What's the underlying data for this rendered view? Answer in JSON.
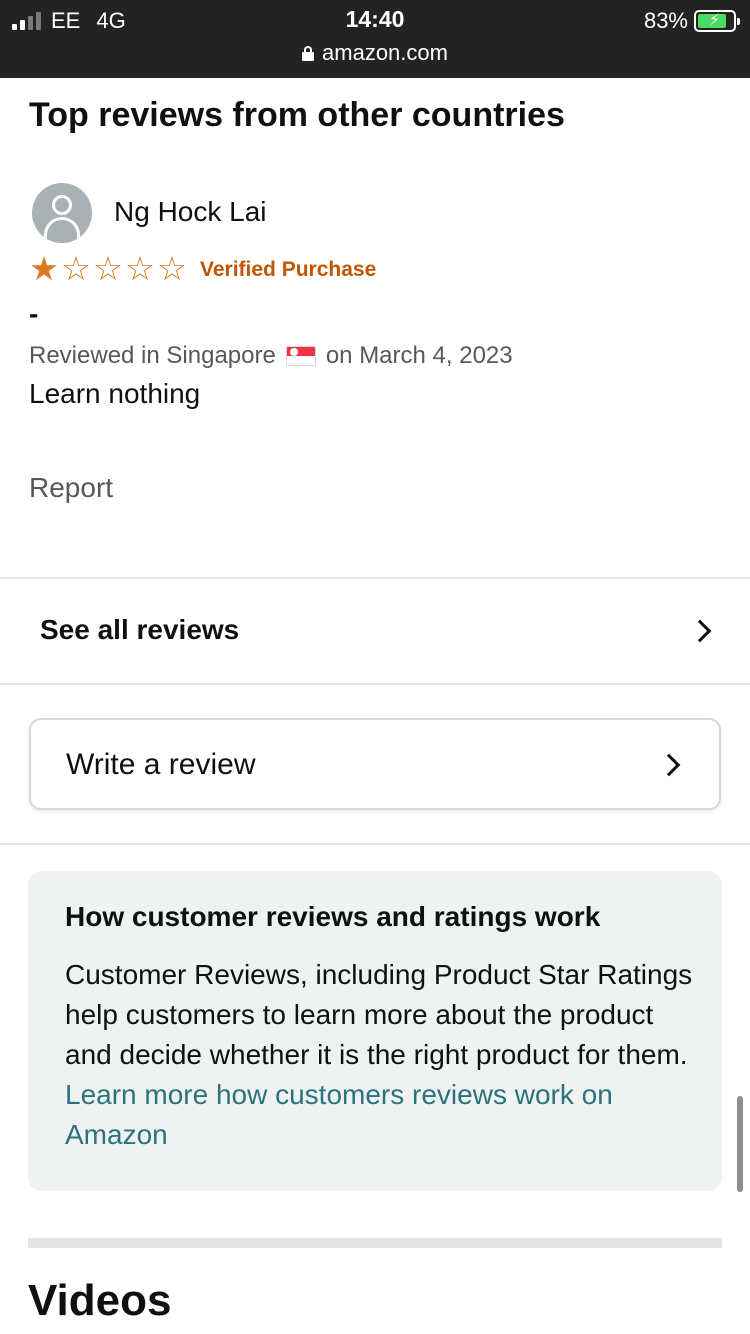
{
  "status_bar": {
    "carrier": "EE",
    "network": "4G",
    "time": "14:40",
    "url": "amazon.com",
    "battery": "83%",
    "battery_level": 0.83,
    "signal_bars": 2
  },
  "section_title": "Top reviews from other countries",
  "review": {
    "reviewer_name": "Ng Hock Lai",
    "rating": 1,
    "max_rating": 5,
    "star_filled": "★",
    "star_empty": "☆",
    "verified_label": "Verified Purchase",
    "title": "-",
    "meta_prefix": "Reviewed in Singapore",
    "meta_suffix": "on March 4, 2023",
    "body": "Learn nothing",
    "report_label": "Report"
  },
  "see_all_label": "See all reviews",
  "write_review_label": "Write a review",
  "info": {
    "title": "How customer reviews and ratings work",
    "text": "Customer Reviews, including Product Star Ratings help customers to learn more about the product and decide whether it is the right product for them.",
    "link": "Learn more how customers reviews work on Amazon"
  },
  "videos_title": "Videos",
  "colors": {
    "star": "#de7921",
    "verified": "#c45500",
    "link": "#2a737e",
    "status_bar_bg": "#232323",
    "battery_fill": "#4cd964"
  },
  "icons": {
    "lock": "lock-icon",
    "chevron": "chevron-right-icon",
    "avatar": "user-avatar-icon",
    "flag": "singapore-flag-icon"
  }
}
